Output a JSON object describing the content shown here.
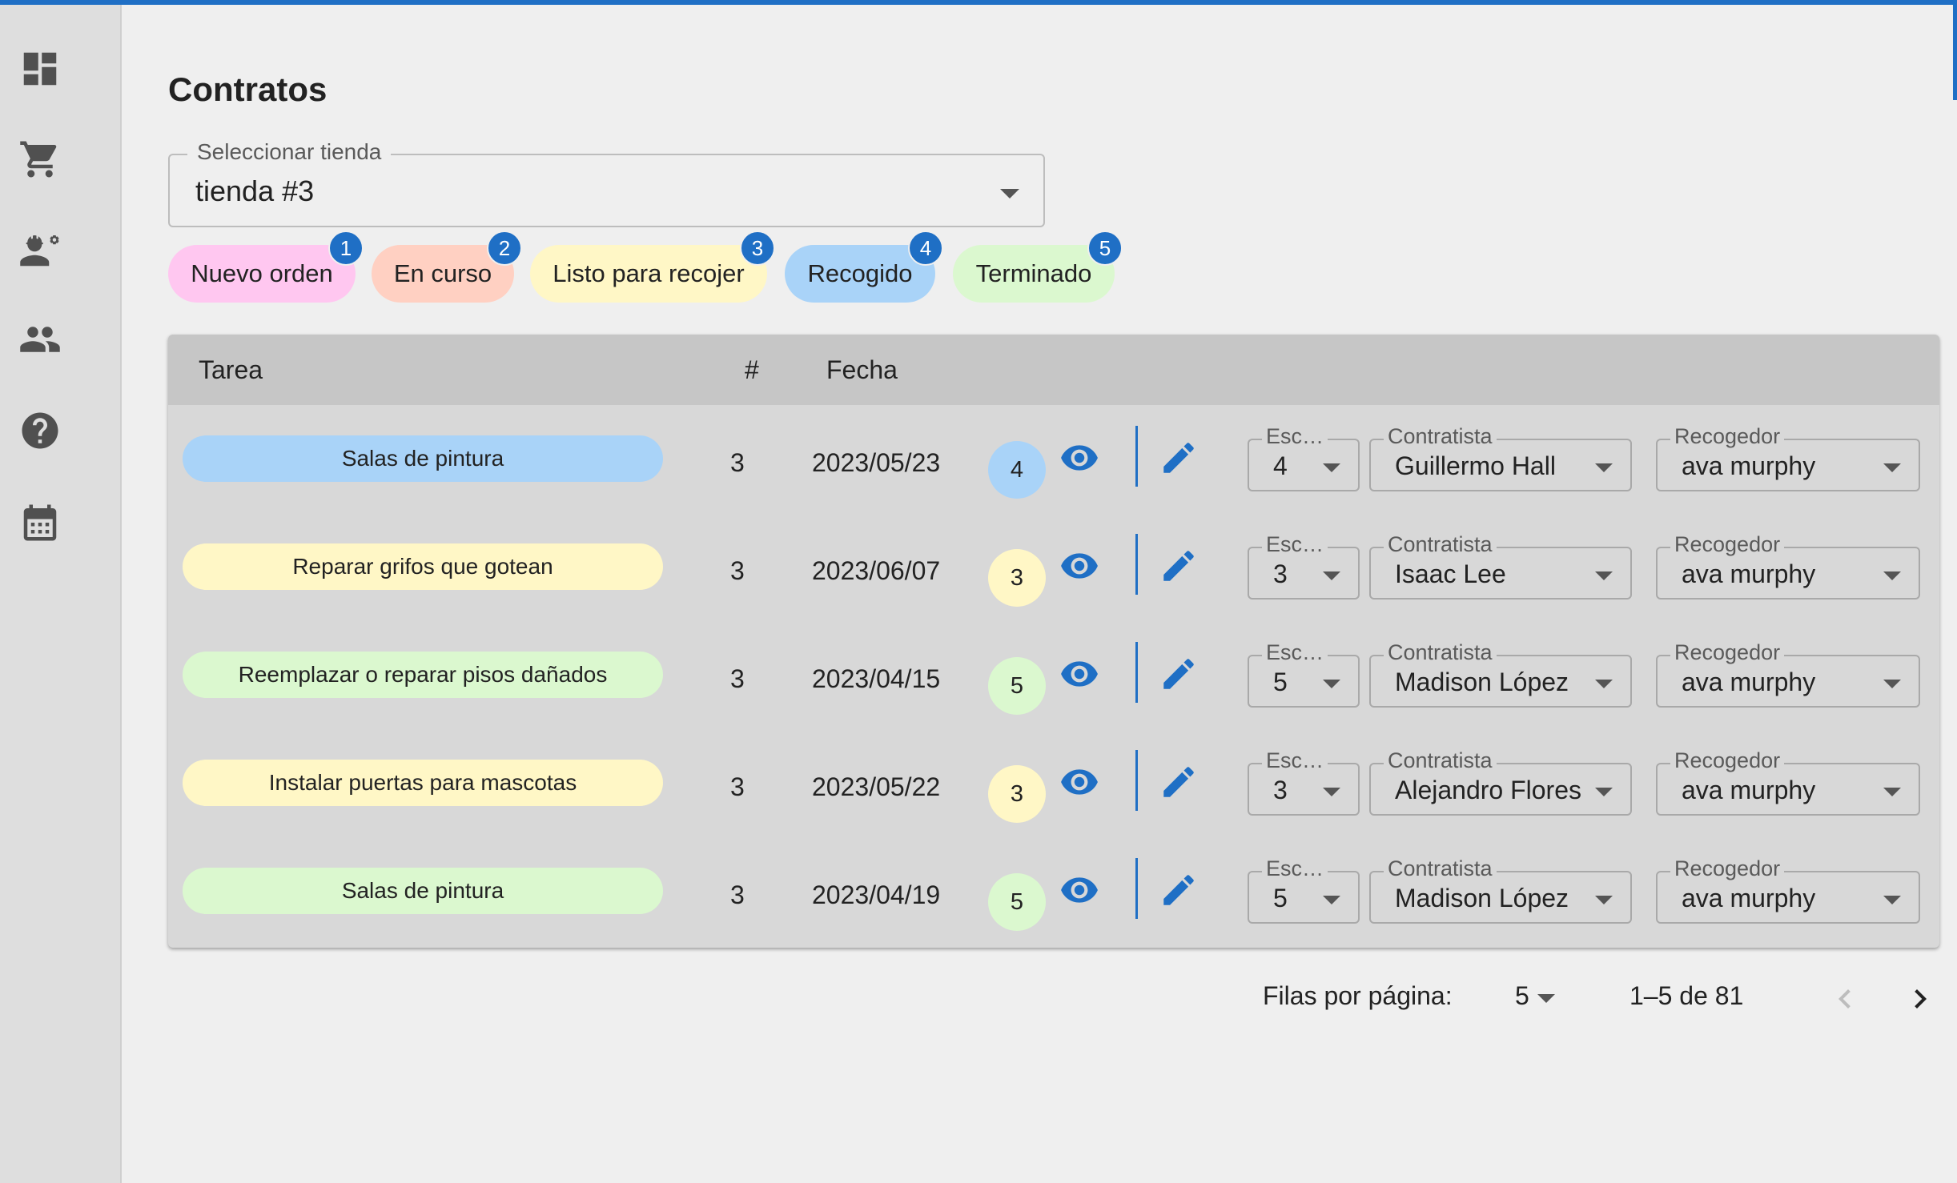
{
  "colors": {
    "accent": "#1f6fc5",
    "status_nuevo": "#ffc7f0",
    "status_en_curso": "#ffd0c2",
    "status_listo": "#fff7c6",
    "status_recogido": "#a9d3f8",
    "status_terminado": "#dbf8cf"
  },
  "sidebar": {
    "items": [
      {
        "icon": "dashboard-icon"
      },
      {
        "icon": "shopping-cart-icon"
      },
      {
        "icon": "engineering-icon"
      },
      {
        "icon": "people-icon"
      },
      {
        "icon": "help-icon"
      },
      {
        "icon": "calendar-icon"
      }
    ]
  },
  "page": {
    "title": "Contratos"
  },
  "store_select": {
    "label": "Seleccionar tienda",
    "value": "tienda #3"
  },
  "status_filters": [
    {
      "label": "Nuevo orden",
      "count": "1"
    },
    {
      "label": "En curso",
      "count": "2"
    },
    {
      "label": "Listo para recojer",
      "count": "3"
    },
    {
      "label": "Recogido",
      "count": "4"
    },
    {
      "label": "Terminado",
      "count": "5"
    }
  ],
  "table": {
    "headers": {
      "task": "Tarea",
      "number": "#",
      "date": "Fecha"
    },
    "rows": [
      {
        "task": "Salas de pintura",
        "number": "3",
        "date": "2023/05/23",
        "status": "4",
        "esc_label": "Esc…",
        "esc": "4",
        "contractor_label": "Contratista",
        "contractor": "Guillermo Hall",
        "picker_label": "Recogedor",
        "picker": "ava murphy"
      },
      {
        "task": "Reparar grifos que gotean",
        "number": "3",
        "date": "2023/06/07",
        "status": "3",
        "esc_label": "Esc…",
        "esc": "3",
        "contractor_label": "Contratista",
        "contractor": "Isaac Lee",
        "picker_label": "Recogedor",
        "picker": "ava murphy"
      },
      {
        "task": "Reemplazar o reparar pisos dañados",
        "number": "3",
        "date": "2023/04/15",
        "status": "5",
        "esc_label": "Esc…",
        "esc": "5",
        "contractor_label": "Contratista",
        "contractor": "Madison López",
        "picker_label": "Recogedor",
        "picker": "ava murphy"
      },
      {
        "task": "Instalar puertas para mascotas",
        "number": "3",
        "date": "2023/05/22",
        "status": "3",
        "esc_label": "Esc…",
        "esc": "3",
        "contractor_label": "Contratista",
        "contractor": "Alejandro Flores",
        "picker_label": "Recogedor",
        "picker": "ava murphy"
      },
      {
        "task": "Salas de pintura",
        "number": "3",
        "date": "2023/04/19",
        "status": "5",
        "esc_label": "Esc…",
        "esc": "5",
        "contractor_label": "Contratista",
        "contractor": "Madison López",
        "picker_label": "Recogedor",
        "picker": "ava murphy"
      }
    ]
  },
  "pagination": {
    "rows_per_page_label": "Filas por página:",
    "rows_per_page": "5",
    "range": "1–5 de 81"
  }
}
